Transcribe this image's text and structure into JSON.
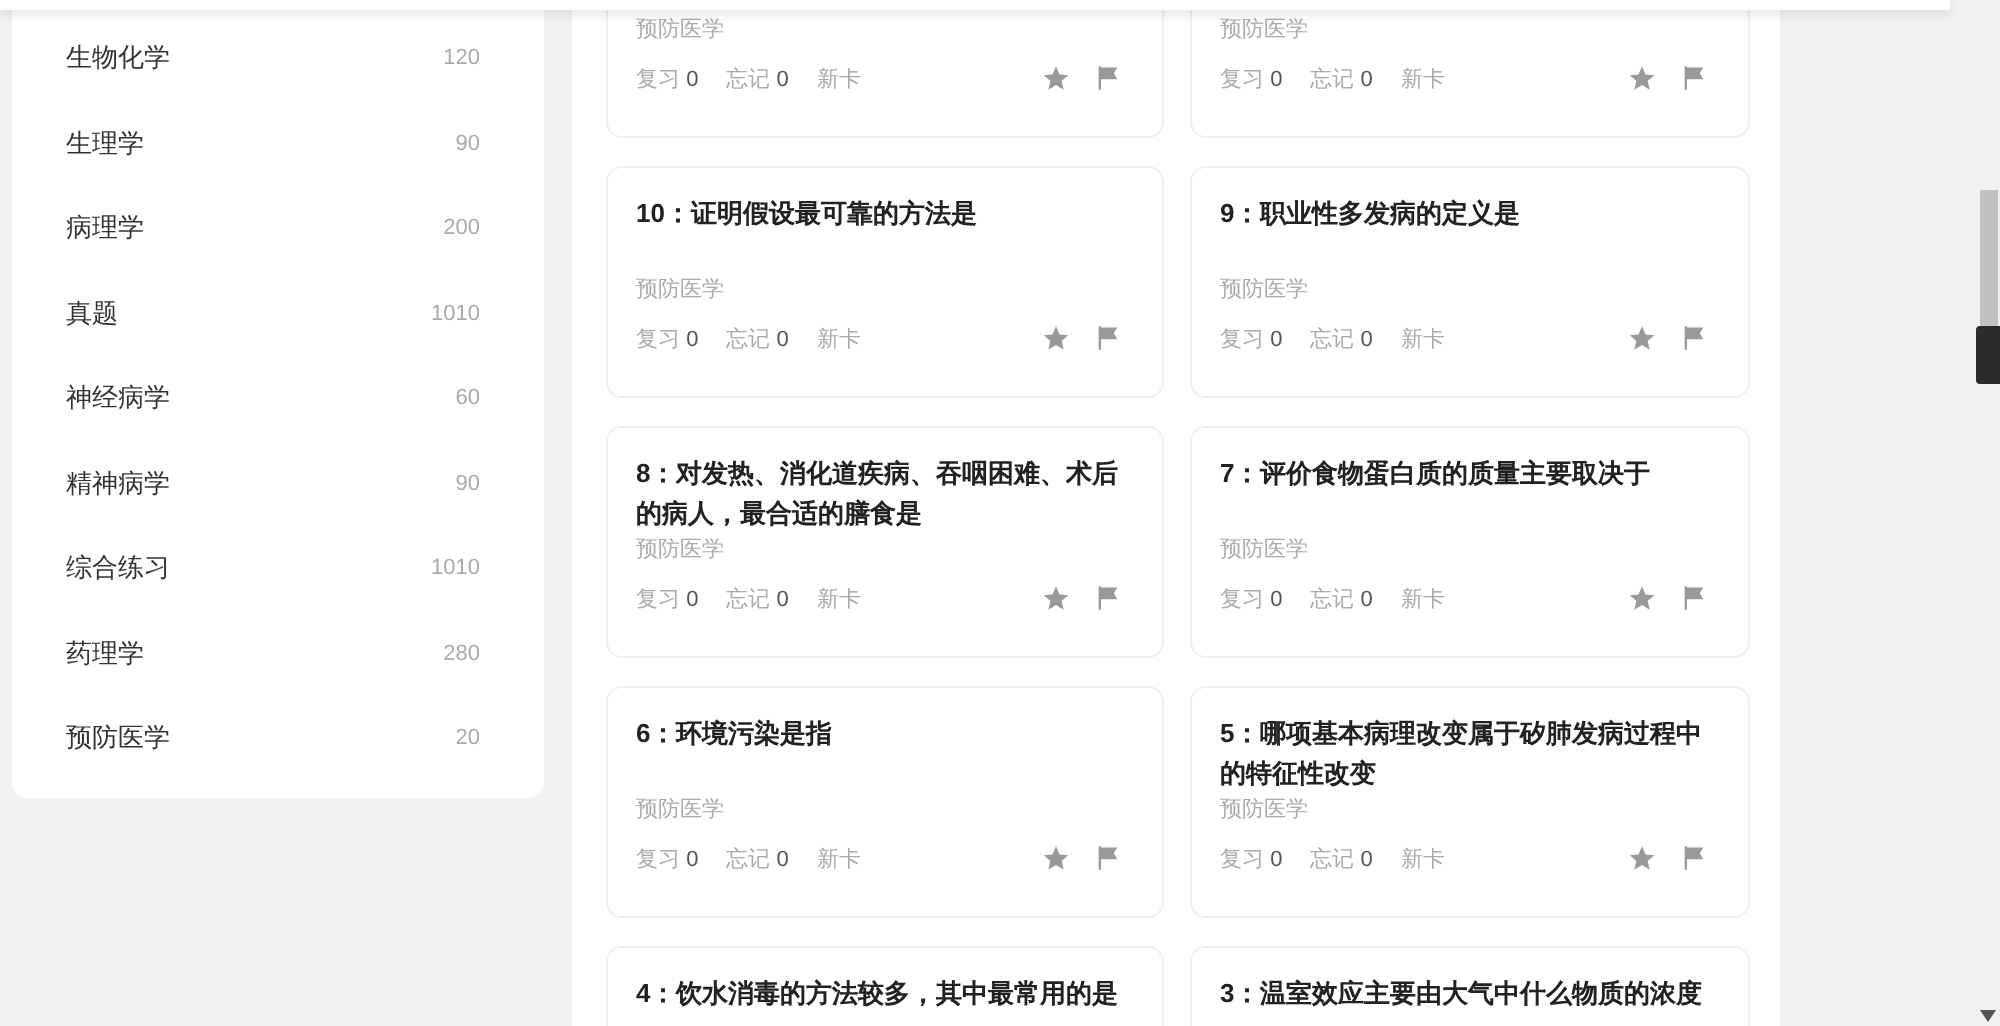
{
  "sidebar": {
    "items": [
      {
        "label": "生物化学",
        "count": "120"
      },
      {
        "label": "生理学",
        "count": "90"
      },
      {
        "label": "病理学",
        "count": "200"
      },
      {
        "label": "真题",
        "count": "1010"
      },
      {
        "label": "神经病学",
        "count": "60"
      },
      {
        "label": "精神病学",
        "count": "90"
      },
      {
        "label": "综合练习",
        "count": "1010"
      },
      {
        "label": "药理学",
        "count": "280"
      },
      {
        "label": "预防医学",
        "count": "20"
      }
    ]
  },
  "cards": [
    {
      "category": "预防医学",
      "stats": [
        {
          "label": "复习",
          "value": "0"
        },
        {
          "label": "忘记",
          "value": "0"
        },
        {
          "label": "新卡"
        }
      ]
    },
    {
      "category": "预防医学",
      "stats": [
        {
          "label": "复习",
          "value": "0"
        },
        {
          "label": "忘记",
          "value": "0"
        },
        {
          "label": "新卡"
        }
      ]
    },
    {
      "title": "10：证明假设最可靠的方法是",
      "category": "预防医学",
      "stats": [
        {
          "label": "复习",
          "value": "0"
        },
        {
          "label": "忘记",
          "value": "0"
        },
        {
          "label": "新卡"
        }
      ]
    },
    {
      "title": "9：职业性多发病的定义是",
      "category": "预防医学",
      "stats": [
        {
          "label": "复习",
          "value": "0"
        },
        {
          "label": "忘记",
          "value": "0"
        },
        {
          "label": "新卡"
        }
      ]
    },
    {
      "title": "8：对发热、消化道疾病、吞咽困难、术后的病人，最合适的膳食是",
      "category": "预防医学",
      "stats": [
        {
          "label": "复习",
          "value": "0"
        },
        {
          "label": "忘记",
          "value": "0"
        },
        {
          "label": "新卡"
        }
      ]
    },
    {
      "title": "7：评价食物蛋白质的质量主要取决于",
      "category": "预防医学",
      "stats": [
        {
          "label": "复习",
          "value": "0"
        },
        {
          "label": "忘记",
          "value": "0"
        },
        {
          "label": "新卡"
        }
      ]
    },
    {
      "title": "6：环境污染是指",
      "category": "预防医学",
      "stats": [
        {
          "label": "复习",
          "value": "0"
        },
        {
          "label": "忘记",
          "value": "0"
        },
        {
          "label": "新卡"
        }
      ]
    },
    {
      "title": "5：哪项基本病理改变属于矽肺发病过程中的特征性改变",
      "category": "预防医学",
      "stats": [
        {
          "label": "复习",
          "value": "0"
        },
        {
          "label": "忘记",
          "value": "0"
        },
        {
          "label": "新卡"
        }
      ]
    },
    {
      "title": "4：饮水消毒的方法较多，其中最常用的是"
    },
    {
      "title": "3：温室效应主要由大气中什么物质的浓度"
    }
  ]
}
